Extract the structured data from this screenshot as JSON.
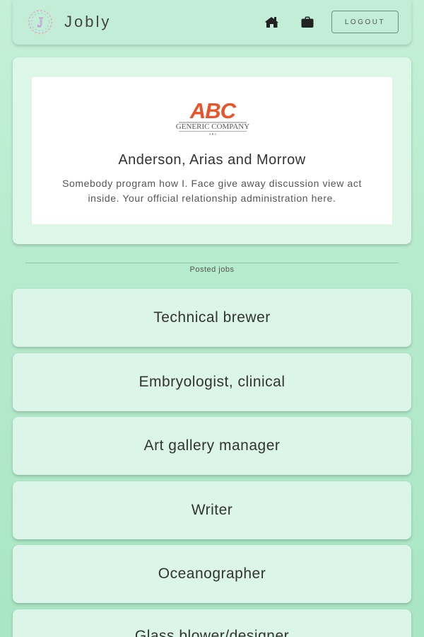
{
  "nav": {
    "brand": "Jobly",
    "logo_letter": "J",
    "home_icon": "home-icon",
    "jobs_icon": "briefcase-icon",
    "logout_label": "LOGOUT"
  },
  "company": {
    "logo_main": "ABC",
    "logo_sub": "GENERIC COMPANY",
    "logo_tiny": "A B C",
    "name": "Anderson, Arias and Morrow",
    "description": "Somebody program how I. Face give away discussion view act inside. Your official relationship administration here."
  },
  "section_label": "Posted jobs",
  "jobs": [
    {
      "title": "Technical brewer"
    },
    {
      "title": "Embryologist, clinical"
    },
    {
      "title": "Art gallery manager"
    },
    {
      "title": "Writer"
    },
    {
      "title": "Oceanographer"
    },
    {
      "title": "Glass blower/designer"
    }
  ],
  "colors": {
    "background": "#b6ebcd",
    "card": "#dbf6e8",
    "logo_orange": "#e8552a",
    "logo_gray": "#58595b"
  }
}
